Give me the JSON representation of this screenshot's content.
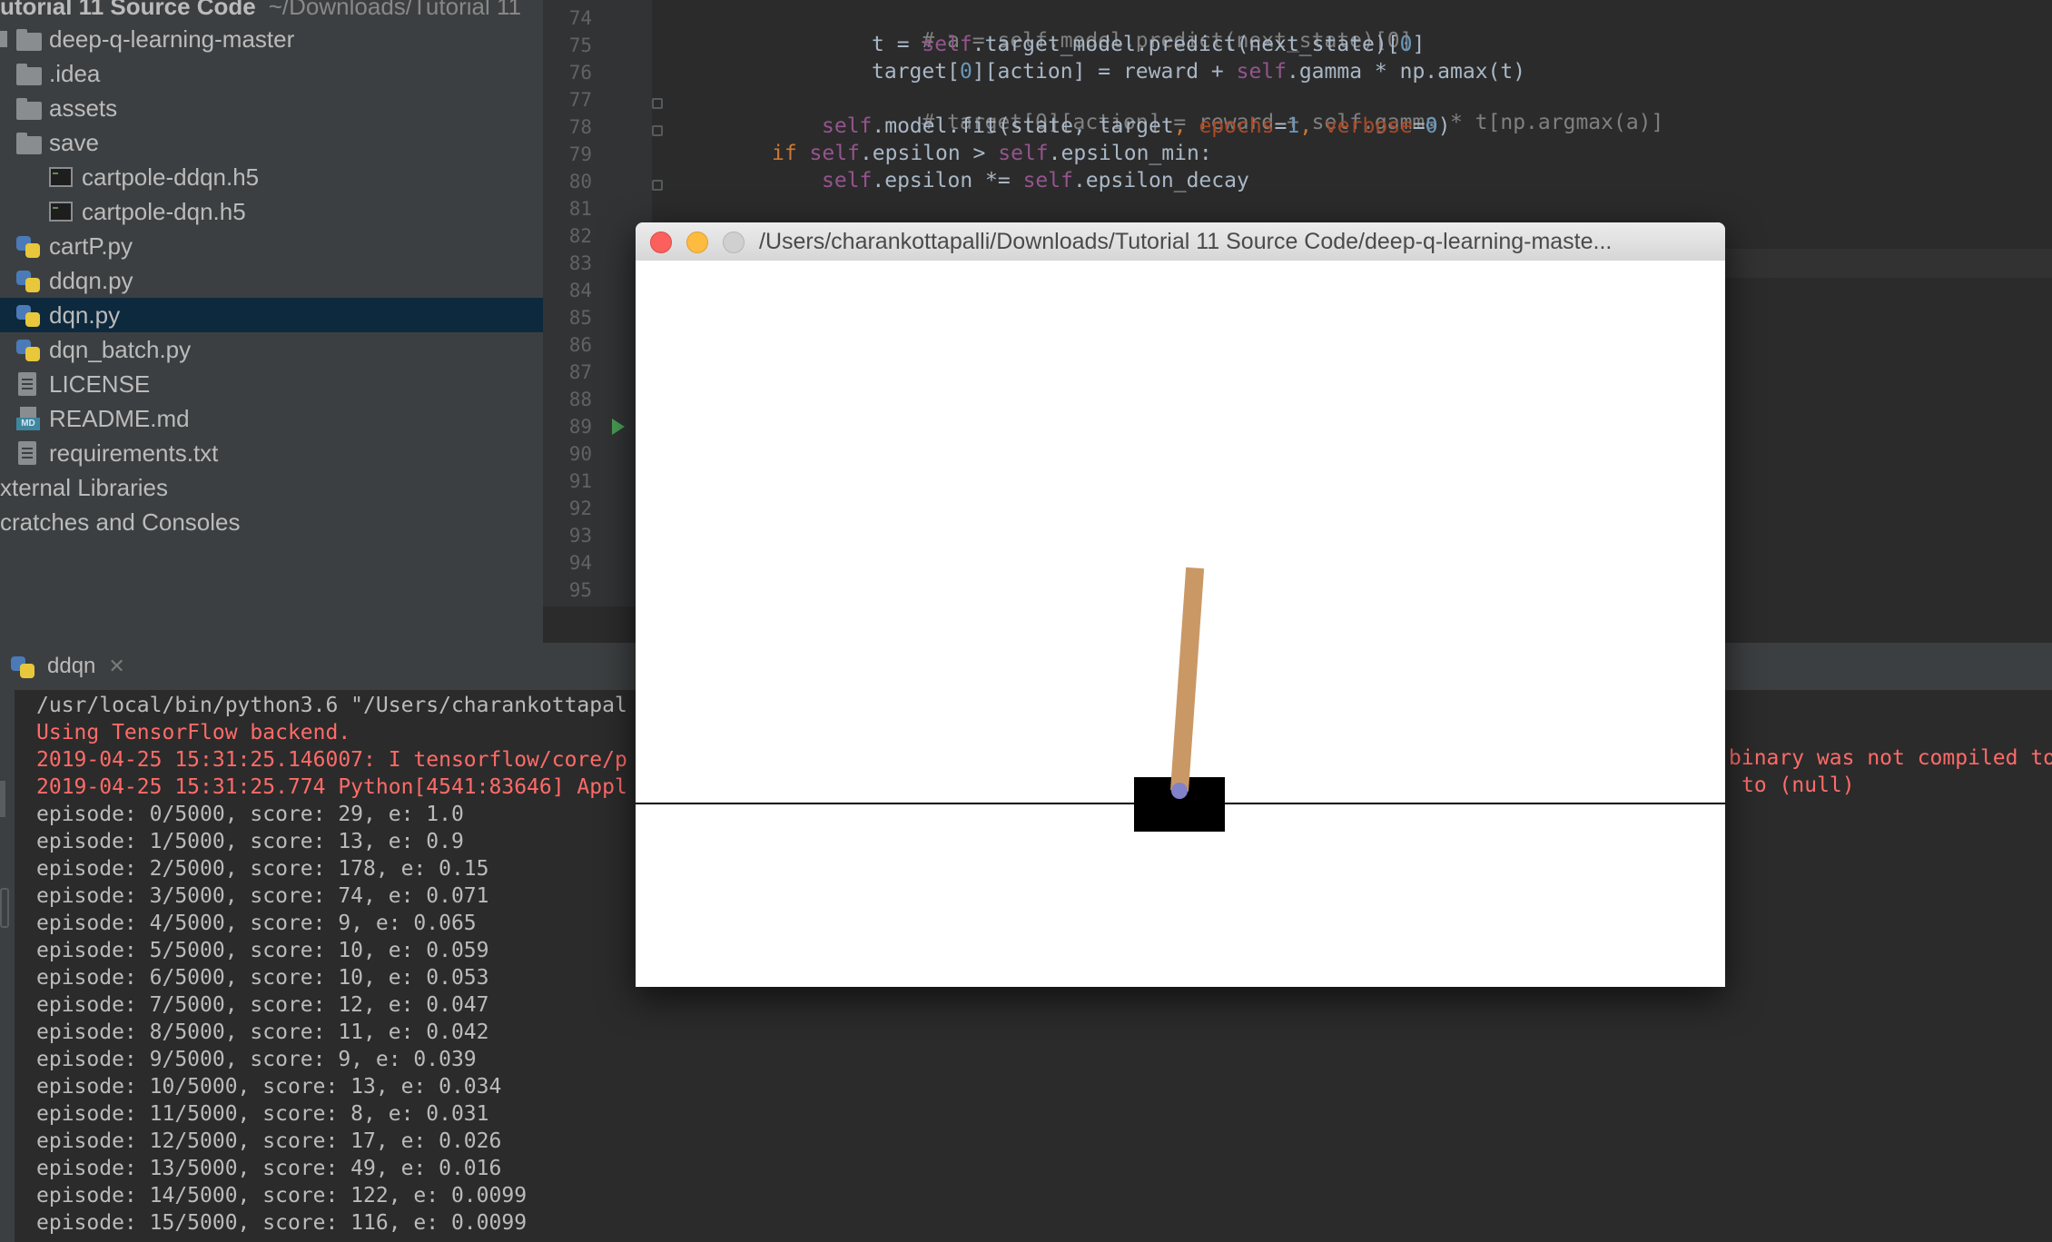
{
  "project": {
    "title": "utorial 11 Source Code",
    "path": "~/Downloads/Tutorial 11",
    "items": [
      {
        "label": "deep-q-learning-master",
        "icon": "folder-open-icon"
      },
      {
        "label": ".idea",
        "icon": "folder-icon"
      },
      {
        "label": "assets",
        "icon": "folder-icon"
      },
      {
        "label": "save",
        "icon": "folder-icon"
      },
      {
        "label": "cartpole-ddqn.h5",
        "icon": "h5-file-icon"
      },
      {
        "label": "cartpole-dqn.h5",
        "icon": "h5-file-icon"
      },
      {
        "label": "cartP.py",
        "icon": "python-file-icon"
      },
      {
        "label": "ddqn.py",
        "icon": "python-file-icon"
      },
      {
        "label": "dqn.py",
        "icon": "python-file-icon",
        "selected": true
      },
      {
        "label": "dqn_batch.py",
        "icon": "python-file-icon"
      },
      {
        "label": "LICENSE",
        "icon": "text-file-icon"
      },
      {
        "label": "README.md",
        "icon": "markdown-file-icon"
      },
      {
        "label": "requirements.txt",
        "icon": "text-file-icon"
      },
      {
        "label": "xternal Libraries",
        "icon": "library-icon"
      },
      {
        "label": "cratches and Consoles",
        "icon": "scratches-icon"
      }
    ]
  },
  "editor": {
    "line_numbers": [
      "74",
      "75",
      "76",
      "77",
      "78",
      "79",
      "80",
      "81",
      "82",
      "83",
      "84",
      "85",
      "86",
      "87",
      "88",
      "89",
      "90",
      "91",
      "92",
      "93",
      "94",
      "95"
    ],
    "code": {
      "l74": "# a = self.model.predict(next_state)[0]",
      "l75a": "t = ",
      "l75b": "self",
      "l75c": ".target_model.predict(next_state)[",
      "l75d": "0",
      "l75e": "]",
      "l76a": "target[",
      "l76b": "0",
      "l76c": "][action] = reward + ",
      "l76d": "self",
      "l76e": ".gamma * np.amax(t)",
      "l77": "# target[0][action] = reward + self.gamma * t[np.argmax(a)]",
      "l78a": "self",
      "l78b": ".model.fit(state, target",
      "l78c": ", ",
      "l78d": "epochs",
      "l78e": "=",
      "l78f": "1",
      "l78g": ", ",
      "l78h": "verbose",
      "l78i": "=",
      "l78j": "0",
      "l78k": ")",
      "l79a": "if ",
      "l79b": "self",
      "l79c": ".epsilon > ",
      "l79d": "self",
      "l79e": ".epsilon_min:",
      "l80a": "self",
      "l80b": ".epsilon *= ",
      "l80c": "self",
      "l80d": ".epsilon_decay"
    }
  },
  "run": {
    "tab_label": "ddqn",
    "lines": [
      {
        "text": "/usr/local/bin/python3.6 \"/Users/charankottapal",
        "type": "cmd"
      },
      {
        "text": "Using TensorFlow backend.",
        "type": "err"
      },
      {
        "text": "2019-04-25 15:31:25.146007: I tensorflow/core/p",
        "type": "err"
      },
      {
        "text": "2019-04-25 15:31:25.774 Python[4541:83646] Appl",
        "type": "err"
      },
      {
        "text": "episode: 0/5000, score: 29, e: 1.0",
        "type": "out"
      },
      {
        "text": "episode: 1/5000, score: 13, e: 0.9",
        "type": "out"
      },
      {
        "text": "episode: 2/5000, score: 178, e: 0.15",
        "type": "out"
      },
      {
        "text": "episode: 3/5000, score: 74, e: 0.071",
        "type": "out"
      },
      {
        "text": "episode: 4/5000, score: 9, e: 0.065",
        "type": "out"
      },
      {
        "text": "episode: 5/5000, score: 10, e: 0.059",
        "type": "out"
      },
      {
        "text": "episode: 6/5000, score: 10, e: 0.053",
        "type": "out"
      },
      {
        "text": "episode: 7/5000, score: 12, e: 0.047",
        "type": "out"
      },
      {
        "text": "episode: 8/5000, score: 11, e: 0.042",
        "type": "out"
      },
      {
        "text": "episode: 9/5000, score: 9, e: 0.039",
        "type": "out"
      },
      {
        "text": "episode: 10/5000, score: 13, e: 0.034",
        "type": "out"
      },
      {
        "text": "episode: 11/5000, score: 8, e: 0.031",
        "type": "out"
      },
      {
        "text": "episode: 12/5000, score: 17, e: 0.026",
        "type": "out"
      },
      {
        "text": "episode: 13/5000, score: 49, e: 0.016",
        "type": "out"
      },
      {
        "text": "episode: 14/5000, score: 122, e: 0.0099",
        "type": "out"
      },
      {
        "text": "episode: 15/5000, score: 116, e: 0.0099",
        "type": "out"
      }
    ],
    "tail_right_1": "binary was not compiled to",
    "tail_right_2": "to (null)"
  },
  "gym_window": {
    "title": "/Users/charankottapalli/Downloads/Tutorial 11 Source Code/deep-q-learning-maste...",
    "pole_angle_deg": 4,
    "colors": {
      "pole": "#ca9865",
      "cart": "#000000",
      "axle": "#8282cb",
      "track": "#000000"
    }
  },
  "colors": {
    "close": "#fc605c",
    "minimize": "#fdbc40",
    "zoom_inactive": "#d0d0d0",
    "error_text": "#ff6b68",
    "selection": "#0d293e"
  }
}
